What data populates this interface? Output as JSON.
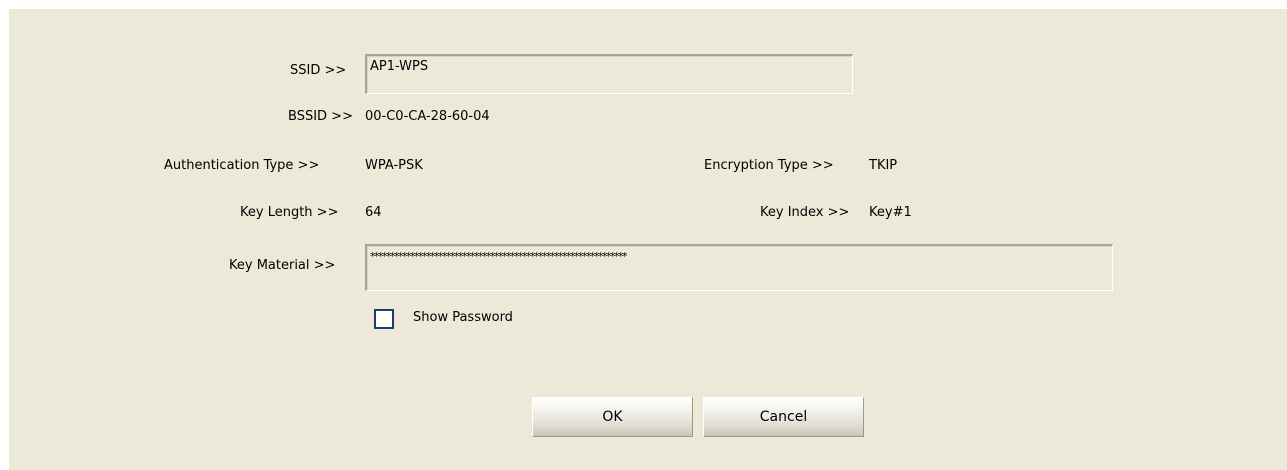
{
  "ssid": {
    "label": "SSID >>",
    "value": "AP1-WPS"
  },
  "bssid": {
    "label": "BSSID >>",
    "value": "00-C0-CA-28-60-04"
  },
  "authentication": {
    "label": "Authentication Type >>",
    "value": "WPA-PSK"
  },
  "encryption": {
    "label": "Encryption Type >>",
    "value": "TKIP"
  },
  "key_length": {
    "label": "Key Length >>",
    "value": "64"
  },
  "key_index": {
    "label": "Key Index >>",
    "value": "Key#1"
  },
  "key_material": {
    "label": "Key Material >>",
    "value": "****************************************************************"
  },
  "show_password": {
    "label": "Show Password",
    "checked": false
  },
  "buttons": {
    "ok": "OK",
    "cancel": "Cancel"
  }
}
